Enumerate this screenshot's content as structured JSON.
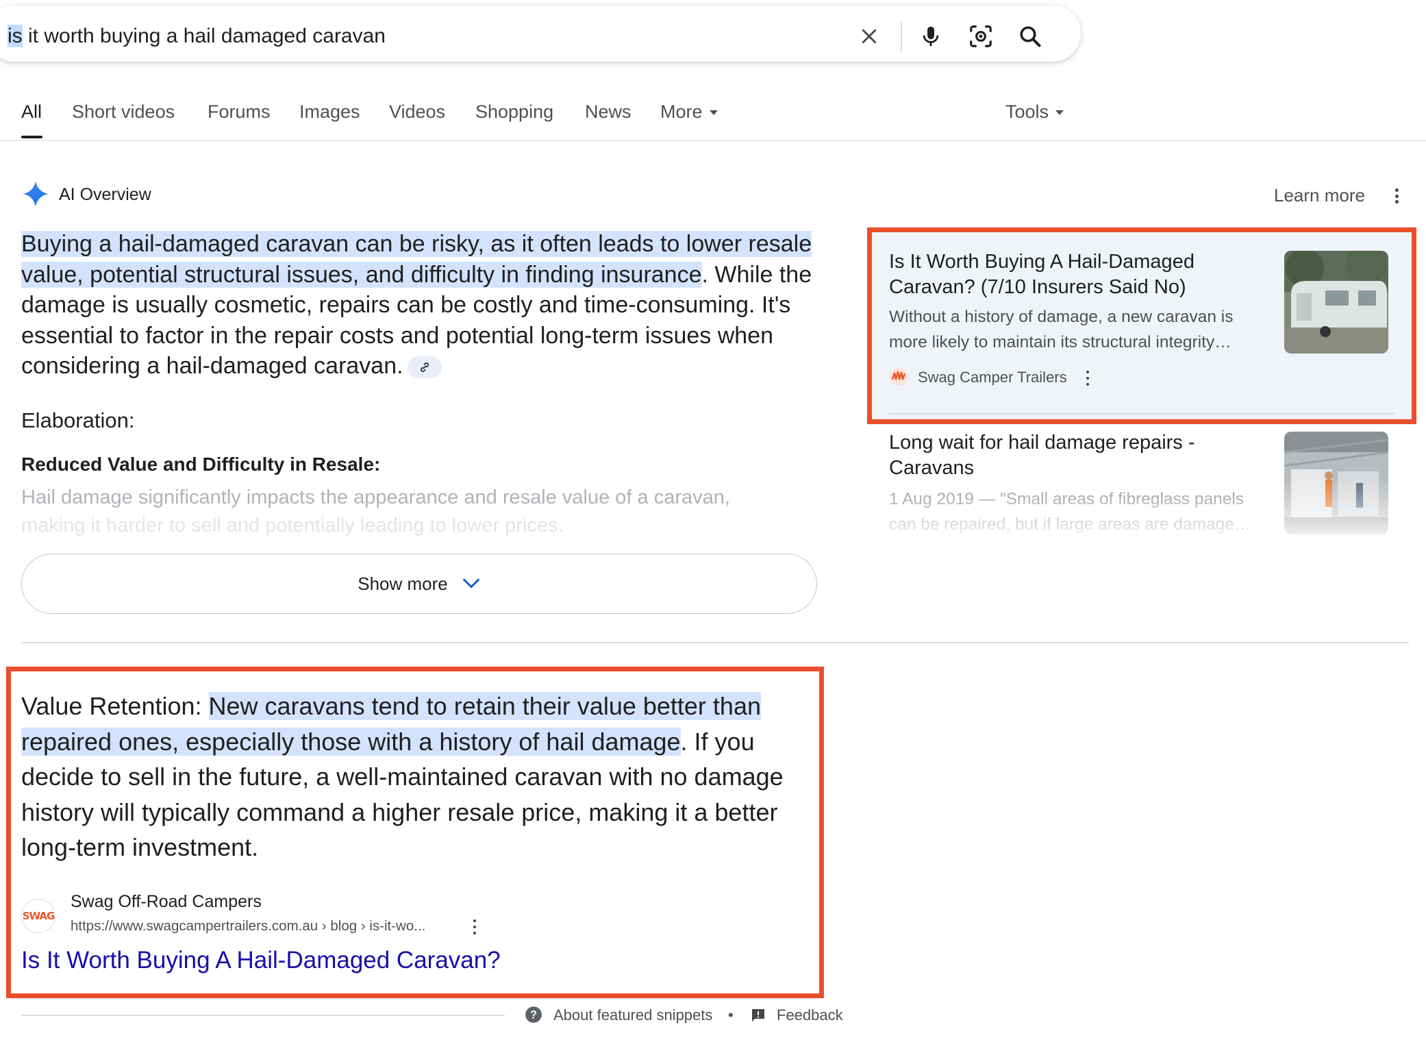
{
  "search": {
    "query_selected": "is",
    "query_rest": " it worth buying a hail damaged caravan"
  },
  "tabs": [
    {
      "label": "All",
      "active": true
    },
    {
      "label": "Short videos"
    },
    {
      "label": "Forums"
    },
    {
      "label": "Images"
    },
    {
      "label": "Videos"
    },
    {
      "label": "Shopping"
    },
    {
      "label": "News"
    },
    {
      "label": "More"
    }
  ],
  "tools_label": "Tools",
  "ai_overview": {
    "title": "AI Overview",
    "learn_more": "Learn more",
    "summary_highlight": "Buying a hail-damaged caravan can be risky, as it often leads to lower resale value, potential structural issues, and difficulty in finding insurance",
    "summary_rest": ". While the damage is usually cosmetic, repairs can be costly and time-consuming. It's essential to factor in the repair costs and potential long-term issues when considering a hail-damaged caravan.",
    "elaboration_label": "Elaboration",
    "elaboration_colon": ":",
    "subheading": "Reduced Value and Difficulty in Resale:",
    "faded_line1": "Hail damage significantly impacts the appearance and resale value of a caravan,",
    "faded_line2": "making it harder to sell and potentially leading to lower prices.",
    "show_more": "Show more"
  },
  "sources": [
    {
      "title": "Is It Worth Buying A Hail-Damaged Caravan? (7/10 Insurers Said No)",
      "snippet": "Without a history of damage, a new caravan is more likely to maintain its structural integrity…",
      "source": "Swag Camper Trailers"
    },
    {
      "title": "Long wait for hail damage repairs - Caravans",
      "snippet": "1 Aug 2019 — \"Small areas of fibreglass panels can be repaired, but if large areas are damage…"
    }
  ],
  "featured_snippet": {
    "lead": "Value Retention: ",
    "highlight": "New caravans tend to retain their value better than repaired ones, especially those with a history of hail damage",
    "rest": ". If you decide to sell in the future, a well-maintained caravan with no damage history will typically command a higher resale price, making it a better long-term investment.",
    "site_name": "Swag Off-Road Campers",
    "url": "https://www.swagcampertrailers.com.au › blog › is-it-wo...",
    "result_title": "Is It Worth Buying A Hail-Damaged Caravan?",
    "favicon_text": "SWAG"
  },
  "footer": {
    "about": "About featured snippets",
    "separator": "•",
    "feedback": "Feedback"
  },
  "colors": {
    "highlight": "#d3e3fd",
    "annotation_red": "#e94e2d",
    "link_blue": "#1a0dab",
    "card_bg": "#f0f4f9"
  }
}
